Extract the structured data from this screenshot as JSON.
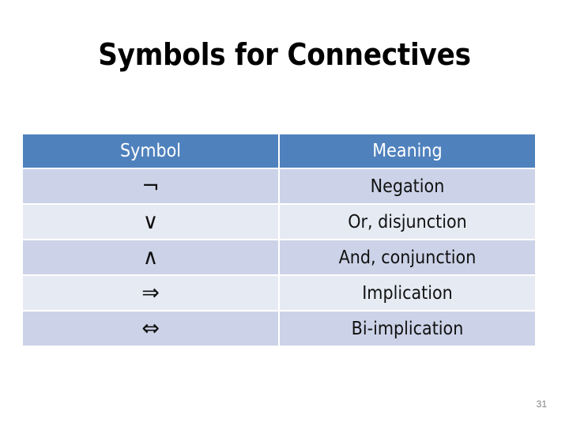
{
  "slide": {
    "title": "Symbols for Connectives",
    "page_number": "31",
    "colors": {
      "header_background": "#4f81bd",
      "header_text": "#ffffff",
      "row_band_dark": "#ccd3e8",
      "row_band_light": "#e6eaf3",
      "body_text": "#111111",
      "page_number_text": "#808080",
      "slide_background": "#ffffff"
    }
  },
  "table": {
    "headers": [
      "Symbol",
      "Meaning"
    ],
    "rows": [
      {
        "symbol": "¬",
        "symbol_name": "negation-sign",
        "meaning": "Negation"
      },
      {
        "symbol": "∨",
        "symbol_name": "logical-or-sign",
        "meaning": "Or, disjunction"
      },
      {
        "symbol": "∧",
        "symbol_name": "logical-and-sign",
        "meaning": "And, conjunction"
      },
      {
        "symbol": "⇒",
        "symbol_name": "double-right-arrow",
        "meaning": "Implication"
      },
      {
        "symbol": "⇔",
        "symbol_name": "double-left-right-arrow",
        "meaning": "Bi-implication"
      }
    ]
  }
}
